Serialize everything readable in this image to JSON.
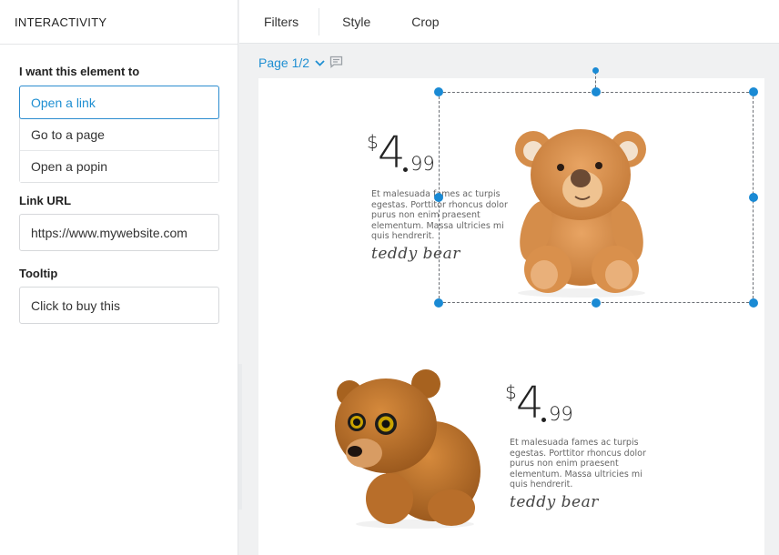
{
  "panel": {
    "title": "INTERACTIVITY",
    "action_label": "I want this element to",
    "options": [
      "Open a link",
      "Go to a page",
      "Open a popin"
    ],
    "selected_option": "Open a link",
    "link_url_label": "Link URL",
    "link_url_value": "https://www.mywebsite.com",
    "tooltip_label": "Tooltip",
    "tooltip_value": "Click to buy this"
  },
  "toolbar": {
    "items": [
      "Filters",
      "Style",
      "Crop"
    ]
  },
  "page_nav": {
    "label": "Page 1/2",
    "chevron_icon": "chevron-down-icon",
    "comment_icon": "comment-icon"
  },
  "products": [
    {
      "currency": "$",
      "price_whole": "4",
      "price_cents": "99",
      "description": "Et malesuada fames ac turpis egestas. Porttitor rhoncus dolor purus non enim praesent elementum. Massa ultricies mi quis hendrerit.",
      "name": "teddy bear",
      "image": "light-brown-teddy-bear"
    },
    {
      "currency": "$",
      "price_whole": "4",
      "price_cents": "99",
      "description": "Et malesuada fames ac turpis egestas. Porttitor rhoncus dolor purus non enim praesent elementum. Massa ultricies mi quis hendrerit.",
      "name": "teddy bear",
      "image": "brown-bear-cub-plush"
    }
  ],
  "colors": {
    "accent": "#1f8fd2",
    "handle": "#1a8ad4"
  }
}
